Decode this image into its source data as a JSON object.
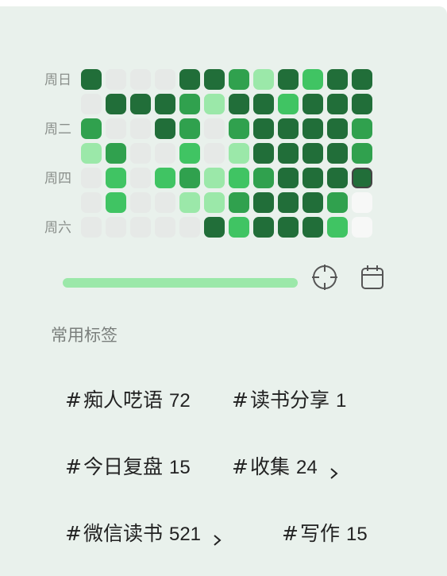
{
  "heatmap": {
    "weekday_labels": [
      "周日",
      "",
      "周二",
      "",
      "周四",
      "",
      "周六"
    ],
    "colors": {
      "0": "#e6e9e7",
      "1": "#9be8a9",
      "2": "#40c463",
      "3": "#30a14e",
      "4": "#216e39",
      "5": "#f7f8f7"
    },
    "grid": [
      [
        4,
        0,
        0,
        0,
        4,
        4,
        3,
        1,
        4,
        2,
        4,
        4
      ],
      [
        0,
        4,
        4,
        4,
        3,
        1,
        4,
        4,
        2,
        4,
        4,
        4
      ],
      [
        3,
        0,
        0,
        4,
        3,
        0,
        3,
        4,
        4,
        4,
        4,
        3
      ],
      [
        1,
        3,
        0,
        0,
        2,
        0,
        1,
        4,
        4,
        4,
        4,
        3
      ],
      [
        0,
        2,
        0,
        2,
        3,
        1,
        2,
        3,
        4,
        4,
        4,
        4
      ],
      [
        0,
        2,
        0,
        0,
        1,
        1,
        3,
        4,
        4,
        4,
        3,
        5
      ],
      [
        0,
        0,
        0,
        0,
        0,
        4,
        2,
        4,
        4,
        4,
        2,
        5
      ]
    ],
    "today": {
      "row": 4,
      "col": 11
    }
  },
  "controls": {
    "slider_value": 1.0,
    "locate_icon": "crosshair-icon",
    "calendar_icon": "calendar-icon"
  },
  "tags_section": {
    "title": "常用标签",
    "tags": [
      {
        "hash": "#",
        "name": "痴人呓语",
        "count": "72",
        "has_chevron": false
      },
      {
        "hash": "#",
        "name": "读书分享",
        "count": "1",
        "has_chevron": false
      },
      {
        "hash": "#",
        "name": "今日复盘",
        "count": "15",
        "has_chevron": false
      },
      {
        "hash": "#",
        "name": "收集",
        "count": "24",
        "has_chevron": true
      },
      {
        "hash": "#",
        "name": "微信读书",
        "count": "521",
        "has_chevron": true
      },
      {
        "hash": "#",
        "name": "写作",
        "count": "15",
        "has_chevron": false
      }
    ]
  }
}
